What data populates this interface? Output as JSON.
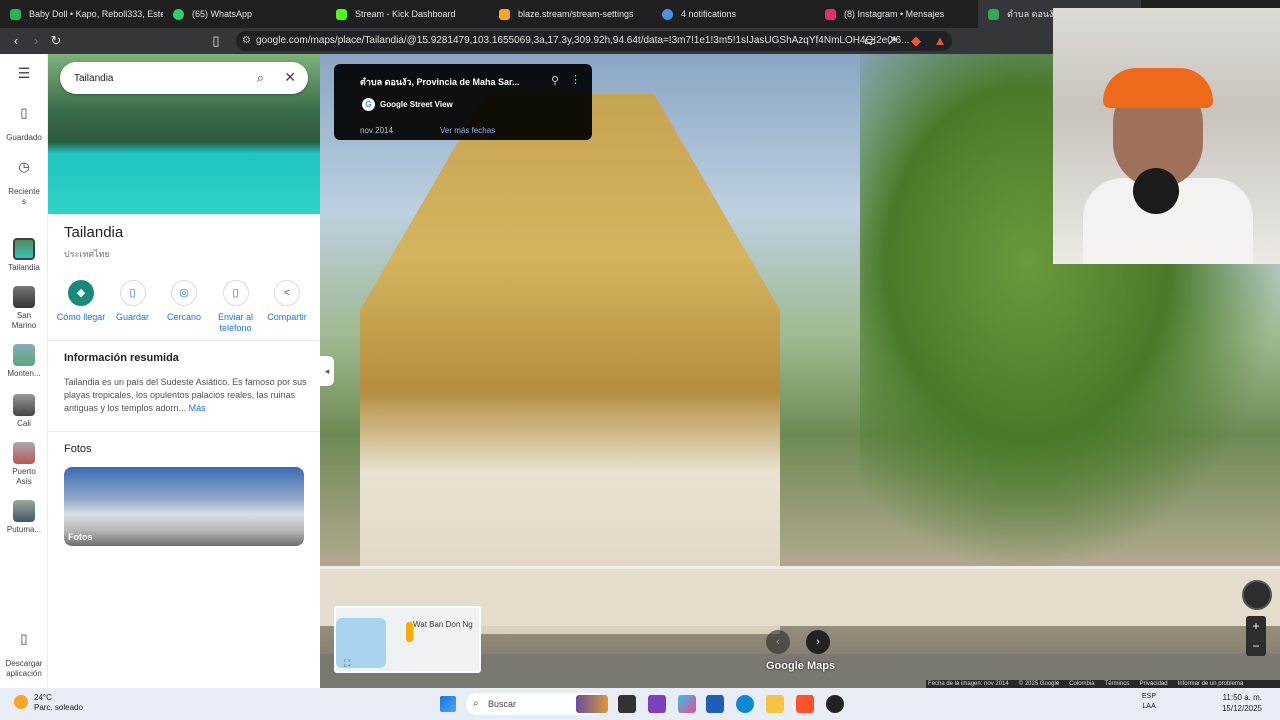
{
  "browser": {
    "tabs": [
      {
        "label": "Baby Doll • Kapo, Reboll333, Este",
        "icon_color": "#1db954"
      },
      {
        "label": "(65) WhatsApp",
        "icon_color": "#25d366"
      },
      {
        "label": "Stream - Kick Dashboard",
        "icon_color": "#53fc18"
      },
      {
        "label": "blaze.stream/stream-settings",
        "icon_color": "#f5a623"
      },
      {
        "label": "4 notifications",
        "icon_color": "#4a90e2"
      },
      {
        "label": "(8) Instagram • Mensajes",
        "icon_color": "#e1306c"
      },
      {
        "label": "ตำบล ดอนงัว, Pr",
        "icon_color": "#34a853"
      }
    ],
    "url": "google.com/maps/place/Tailandia/@15.9281479,103.1655069,3a,17.3y,309.92h,94.64t/data=!3m7!1e1!3m5!1sIJasUGShAzqYf4NmLOH4Q!2e0!6..."
  },
  "maps": {
    "search_value": "Tailandia",
    "rail": [
      {
        "label": "Guardado",
        "icon": "bookmark-icon"
      },
      {
        "label": "Reciente\ns",
        "icon": "history-icon"
      },
      {
        "label": "Tailandia",
        "icon": "thumb-tailandia"
      },
      {
        "label": "San\nMarino",
        "icon": "thumb-san-marino"
      },
      {
        "label": "Monten...",
        "icon": "thumb-montenegro"
      },
      {
        "label": "Cali",
        "icon": "thumb-cali"
      },
      {
        "label": "Puerto\nAsís",
        "icon": "thumb-puerto-asis"
      },
      {
        "label": "Putuma...",
        "icon": "thumb-putumayo"
      },
      {
        "label": "Descargar\naplicación",
        "icon": "phone-icon"
      }
    ],
    "place": {
      "title": "Tailandia",
      "subtitle": "ประเทศไทย"
    },
    "actions": [
      {
        "label": "Cómo llegar",
        "icon": "directions-icon"
      },
      {
        "label": "Guardar",
        "icon": "bookmark-icon"
      },
      {
        "label": "Cercano",
        "icon": "nearby-icon"
      },
      {
        "label": "Enviar al teléfono",
        "icon": "send-to-phone-icon"
      },
      {
        "label": "Compartir",
        "icon": "share-icon"
      }
    ],
    "summary_title": "Información resumida",
    "summary_text": "Tailandia es un país del Sudeste Asiático. Es famoso por sus playas tropicales, los opulentos palacios reales, las ruinas antiguas y los templos adorn...",
    "summary_more": "Más",
    "photos_title": "Fotos",
    "photos_label": "Fotos"
  },
  "streetview": {
    "location": "ตำบล ดอนงัว, Provincia de Maha Sar...",
    "source": "Google Street View",
    "date": "nov 2014",
    "more_dates": "Ver más fechas",
    "minimap_place": "Wat Ban Don Ng",
    "logo": "Google Maps",
    "footer": [
      "Fecha de la imagen: nov 2014",
      "© 2025 Google",
      "Colombia",
      "Términos",
      "Privacidad",
      "Informar de un problema"
    ]
  },
  "taskbar": {
    "temp": "24°C",
    "weather": "Parc. soleado",
    "search_placeholder": "Buscar",
    "lang": "ESP",
    "lang2": "LAA",
    "time": "11:50 a. m.",
    "date": "15/12/2025"
  }
}
